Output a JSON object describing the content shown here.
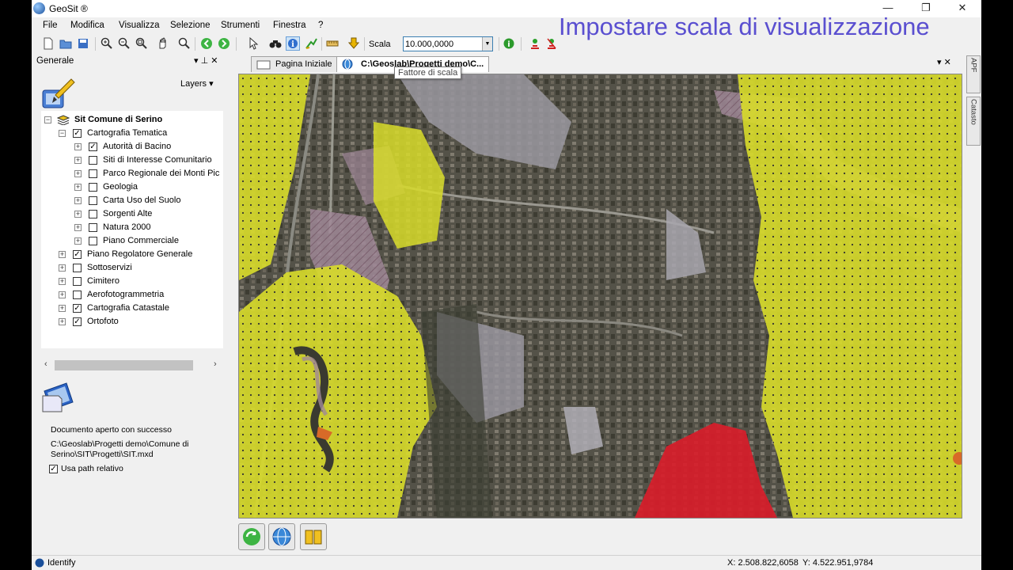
{
  "window": {
    "title": "GeoSit ®",
    "minimize_label": "—",
    "restore_label": "❐",
    "close_label": "✕"
  },
  "overlay_caption": "Impostare scala di visualizzazione",
  "menu": [
    "File",
    "Modifica",
    "Visualizza",
    "Selezione",
    "Strumenti",
    "Finestra",
    "?"
  ],
  "toolbar": {
    "icons": [
      "new-document-icon",
      "open-folder-icon",
      "save-icon",
      "zoom-in-icon",
      "zoom-out-icon",
      "zoom-extent-icon",
      "pan-hand-icon",
      "zoom-window-icon",
      "back-icon",
      "forward-icon",
      "select-pointer-icon",
      "find-binoculars-icon",
      "identify-icon",
      "measure-icon",
      "ruler-icon",
      "download-arrow-icon",
      "info-icon",
      "gps-icon",
      "gps-off-icon"
    ],
    "scale_label": "Scala",
    "scale_value": "10.000,0000",
    "scale_tooltip": "Fattore di scala"
  },
  "left_panel": {
    "title": "Generale",
    "pin_label": "▾  ⊥  ✕",
    "layers_button": "Layers  ▾",
    "tree": [
      {
        "level": 0,
        "expander": "⊟",
        "checkbox": null,
        "label": "Sit Comune di Serino",
        "bold": true
      },
      {
        "level": 1,
        "expander": "⊟",
        "checkbox": true,
        "label": "Cartografia Tematica"
      },
      {
        "level": 2,
        "expander": "⊞",
        "checkbox": true,
        "label": "Autorità di Bacino"
      },
      {
        "level": 2,
        "expander": "⊞",
        "checkbox": false,
        "label": "Siti di Interesse Comunitario"
      },
      {
        "level": 2,
        "expander": "⊞",
        "checkbox": false,
        "label": "Parco Regionale dei Monti Pic"
      },
      {
        "level": 2,
        "expander": "⊞",
        "checkbox": false,
        "label": "Geologia"
      },
      {
        "level": 2,
        "expander": "⊞",
        "checkbox": false,
        "label": "Carta Uso del Suolo"
      },
      {
        "level": 2,
        "expander": "⊞",
        "checkbox": false,
        "label": "Sorgenti Alte"
      },
      {
        "level": 2,
        "expander": "⊞",
        "checkbox": false,
        "label": "Natura 2000"
      },
      {
        "level": 2,
        "expander": "⊞",
        "checkbox": false,
        "label": "Piano Commerciale"
      },
      {
        "level": 1,
        "expander": "⊞",
        "checkbox": true,
        "label": "Piano Regolatore Generale"
      },
      {
        "level": 1,
        "expander": "⊞",
        "checkbox": false,
        "label": "Sottoservizi"
      },
      {
        "level": 1,
        "expander": "⊞",
        "checkbox": false,
        "label": "Cimitero"
      },
      {
        "level": 1,
        "expander": "⊞",
        "checkbox": false,
        "label": "Aerofotogrammetria"
      },
      {
        "level": 1,
        "expander": "⊞",
        "checkbox": true,
        "label": "Cartografia Catastale"
      },
      {
        "level": 1,
        "expander": "⊞",
        "checkbox": true,
        "label": "Ortofoto"
      }
    ],
    "status_message": "Documento aperto con successo",
    "document_path": "C:\\Geoslab\\Progetti demo\\Comune di Serino\\SIT\\Progetti\\SIT.mxd",
    "relative_path_label": "Usa path relativo",
    "relative_path_checked": true
  },
  "tabs": [
    {
      "label": "Pagina Iniziale",
      "active": false
    },
    {
      "label": "C:\\Geoslab\\Progetti demo\\C...",
      "active": true
    }
  ],
  "tab_controls": "▾  ✕",
  "side_tabs": [
    "APF",
    "Catasto"
  ],
  "bottom_buttons": [
    "map-refresh-icon",
    "globe-icon",
    "book-icon"
  ],
  "status": {
    "tool": "Identify",
    "x_coord": "X: 2.508.822,6058",
    "y_coord": "Y: 4.522.951,9784"
  },
  "colors": {
    "zone_yellow": "#d8dc2a",
    "zone_red": "#d81d2a",
    "zone_mauve": "#a08898",
    "caption": "#5a4fd0"
  }
}
